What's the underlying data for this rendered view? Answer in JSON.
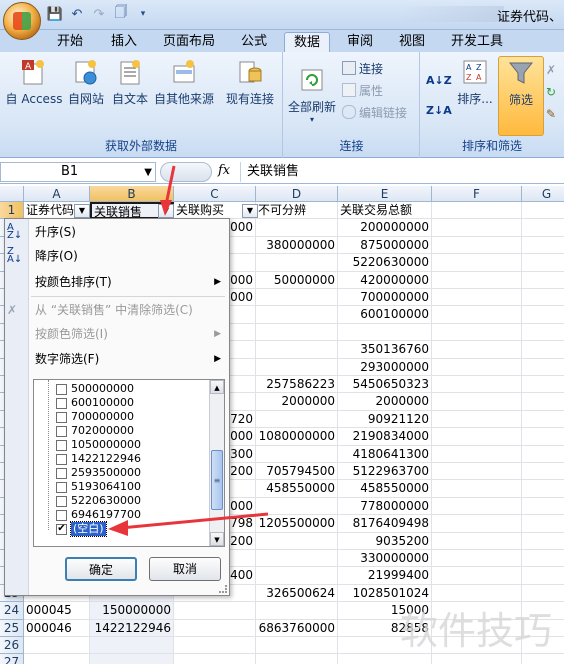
{
  "window": {
    "title_right": "证券代码、"
  },
  "tabs": [
    "开始",
    "插入",
    "页面布局",
    "公式",
    "数据",
    "审阅",
    "视图",
    "开发工具"
  ],
  "active_tab": "数据",
  "ribbon": {
    "external_data": {
      "label": "获取外部数据",
      "buttons": [
        "自 Access",
        "自网站",
        "自文本",
        "自其他来源",
        "现有连接"
      ]
    },
    "connections": {
      "label": "连接",
      "refresh_all": "全部刷新",
      "connections": "连接",
      "properties": "属性",
      "edit_links": "编辑链接"
    },
    "sort_filter": {
      "label": "排序和筛选",
      "sort": "排序...",
      "filter": "筛选"
    }
  },
  "formula_bar": {
    "name_box": "B1",
    "fx": "fx",
    "content": "关联销售"
  },
  "grid": {
    "columns": [
      "A",
      "B",
      "C",
      "D",
      "E",
      "F",
      "G"
    ],
    "rows": [
      {
        "n": "1",
        "A": "证券代码",
        "B": "关联销售",
        "C": "关联购买",
        "D": "不可分辨",
        "E": "关联交易总额"
      },
      {
        "n": "2",
        "A": "",
        "B": "",
        "C": "0000",
        "D": "",
        "E": "200000000"
      },
      {
        "n": "3",
        "A": "",
        "B": "",
        "C": "",
        "D": "380000000",
        "E": "875000000"
      },
      {
        "n": "4",
        "A": "",
        "B": "",
        "C": "",
        "D": "",
        "E": "5220630000"
      },
      {
        "n": "5",
        "A": "",
        "B": "",
        "C": "0000",
        "D": "50000000",
        "E": "420000000"
      },
      {
        "n": "6",
        "A": "",
        "B": "",
        "C": "0000",
        "D": "",
        "E": "700000000"
      },
      {
        "n": "7",
        "A": "",
        "B": "",
        "C": "",
        "D": "",
        "E": "600100000"
      },
      {
        "n": "8",
        "A": "",
        "B": "",
        "C": "",
        "D": "",
        "E": ""
      },
      {
        "n": "9",
        "A": "",
        "B": "",
        "C": "",
        "D": "",
        "E": "350136760"
      },
      {
        "n": "10",
        "A": "",
        "B": "",
        "C": "",
        "D": "",
        "E": "293000000"
      },
      {
        "n": "11",
        "A": "",
        "B": "",
        "C": "",
        "D": "257586223",
        "E": "5450650323"
      },
      {
        "n": "12",
        "A": "",
        "B": "",
        "C": "",
        "D": "2000000",
        "E": "2000000"
      },
      {
        "n": "13",
        "A": "",
        "B": "",
        "C": "0720",
        "D": "",
        "E": "90921120"
      },
      {
        "n": "14",
        "A": "",
        "B": "",
        "C": "4000",
        "D": "1080000000",
        "E": "2190834000"
      },
      {
        "n": "15",
        "A": "",
        "B": "",
        "C": "1300",
        "D": "",
        "E": "4180641300"
      },
      {
        "n": "16",
        "A": "",
        "B": "",
        "C": "9200",
        "D": "705794500",
        "E": "5122963700"
      },
      {
        "n": "17",
        "A": "",
        "B": "",
        "C": "",
        "D": "458550000",
        "E": "458550000"
      },
      {
        "n": "18",
        "A": "",
        "B": "",
        "C": "0000",
        "D": "",
        "E": "778000000"
      },
      {
        "n": "19",
        "A": "",
        "B": "",
        "C": "1798",
        "D": "1205500000",
        "E": "8176409498"
      },
      {
        "n": "20",
        "A": "",
        "B": "",
        "C": "5200",
        "D": "",
        "E": "9035200"
      },
      {
        "n": "21",
        "A": "",
        "B": "",
        "C": "",
        "D": "",
        "E": "330000000"
      },
      {
        "n": "22",
        "A": "",
        "B": "",
        "C": "9400",
        "D": "",
        "E": "21999400"
      },
      {
        "n": "23",
        "A": "",
        "B": "",
        "C": "",
        "D": "326500624",
        "E": "1028501024"
      },
      {
        "n": "24",
        "A": "000045",
        "B": "150000000",
        "C": "",
        "D": "",
        "E": "15000"
      },
      {
        "n": "25",
        "A": "000046",
        "B": "1422122946",
        "C": "",
        "D": "6863760000",
        "E": "82858"
      },
      {
        "n": "26",
        "A": "",
        "B": "",
        "C": "",
        "D": "",
        "E": ""
      },
      {
        "n": "27",
        "A": "",
        "B": "",
        "C": "",
        "D": "",
        "E": ""
      },
      {
        "n": "28",
        "A": "",
        "B": "",
        "C": "",
        "D": "",
        "E": ""
      }
    ]
  },
  "filter_menu": {
    "sort_asc": "升序(S)",
    "sort_desc": "降序(O)",
    "sort_by_color": "按颜色排序(T)",
    "clear_filter": "从 “关联销售” 中清除筛选(C)",
    "filter_by_color": "按颜色筛选(I)",
    "number_filter": "数字筛选(F)",
    "checklist": [
      {
        "label": "500000000",
        "checked": false
      },
      {
        "label": "600100000",
        "checked": false
      },
      {
        "label": "700000000",
        "checked": false
      },
      {
        "label": "702000000",
        "checked": false
      },
      {
        "label": "1050000000",
        "checked": false
      },
      {
        "label": "1422122946",
        "checked": false
      },
      {
        "label": "2593500000",
        "checked": false
      },
      {
        "label": "5193064100",
        "checked": false
      },
      {
        "label": "5220630000",
        "checked": false
      },
      {
        "label": "6946197700",
        "checked": false
      },
      {
        "label": "(空白)",
        "checked": true
      }
    ],
    "ok": "确定",
    "cancel": "取消"
  },
  "watermark": "软件技巧",
  "colors": {
    "accent": "#e8353b",
    "ribbon_bg": "#dbe8f8",
    "selection": "#2a62c9"
  }
}
